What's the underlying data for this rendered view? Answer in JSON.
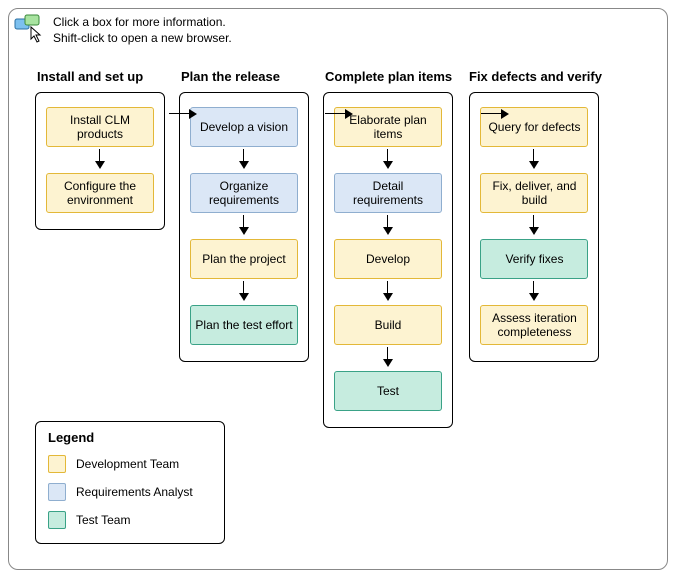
{
  "hint": {
    "line1": "Click a box for more information.",
    "line2": "Shift-click to open a new browser."
  },
  "columns": [
    {
      "title": "Install and set up",
      "nodes": [
        {
          "label": "Install CLM products",
          "role": "dev"
        },
        {
          "label": "Configure the environment",
          "role": "dev"
        }
      ]
    },
    {
      "title": "Plan the release",
      "nodes": [
        {
          "label": "Develop a vision",
          "role": "req"
        },
        {
          "label": "Organize requirements",
          "role": "req"
        },
        {
          "label": "Plan the project",
          "role": "dev"
        },
        {
          "label": "Plan the test effort",
          "role": "test"
        }
      ]
    },
    {
      "title": "Complete plan items",
      "nodes": [
        {
          "label": "Elaborate plan items",
          "role": "dev"
        },
        {
          "label": "Detail requirements",
          "role": "req"
        },
        {
          "label": "Develop",
          "role": "dev"
        },
        {
          "label": "Build",
          "role": "dev"
        },
        {
          "label": "Test",
          "role": "test"
        }
      ]
    },
    {
      "title": "Fix defects and verify",
      "nodes": [
        {
          "label": "Query for defects",
          "role": "dev"
        },
        {
          "label": "Fix, deliver, and build",
          "role": "dev"
        },
        {
          "label": "Verify fixes",
          "role": "test"
        },
        {
          "label": "Assess iteration completeness",
          "role": "dev"
        }
      ]
    }
  ],
  "legend": {
    "title": "Legend",
    "items": [
      {
        "label": "Development Team",
        "role": "dev"
      },
      {
        "label": "Requirements Analyst",
        "role": "req"
      },
      {
        "label": "Test Team",
        "role": "test"
      }
    ]
  },
  "colors": {
    "dev_bg": "#fdf3d1",
    "dev_border": "#e3b838",
    "req_bg": "#dbe7f6",
    "req_border": "#8faecf",
    "test_bg": "#c6ecdf",
    "test_border": "#3aa287"
  }
}
